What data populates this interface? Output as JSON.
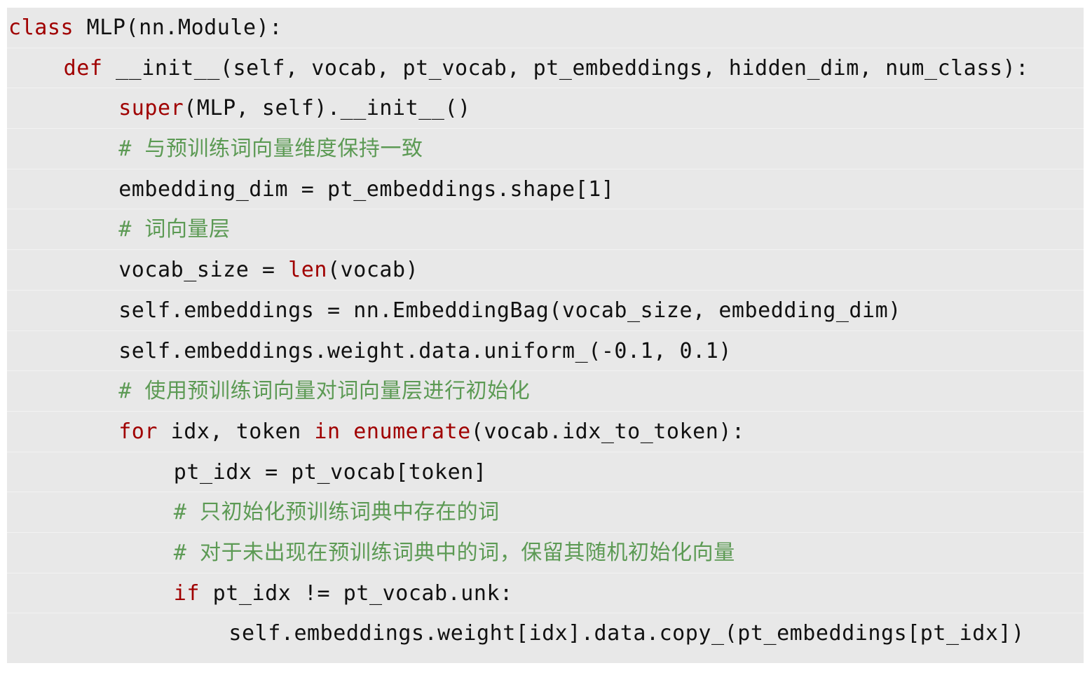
{
  "colors": {
    "background": "#e8e8e8",
    "text": "#111111",
    "keyword": "#a00000",
    "comment": "#5c9a54"
  },
  "code": {
    "lines": [
      {
        "indent": 0,
        "segments": [
          {
            "t": "kw",
            "v": "class"
          },
          {
            "t": "tx",
            "v": " MLP(nn.Module):"
          }
        ]
      },
      {
        "indent": 1,
        "segments": [
          {
            "t": "kw",
            "v": "def"
          },
          {
            "t": "tx",
            "v": " __init__(self, vocab, pt_vocab, pt_embeddings, hidden_dim, num_class):"
          }
        ]
      },
      {
        "indent": 2,
        "segments": [
          {
            "t": "kw",
            "v": "super"
          },
          {
            "t": "tx",
            "v": "(MLP, self).__init__()"
          }
        ]
      },
      {
        "indent": 2,
        "segments": [
          {
            "t": "cm",
            "v": "# 与预训练词向量维度保持一致"
          }
        ]
      },
      {
        "indent": 2,
        "segments": [
          {
            "t": "tx",
            "v": "embedding_dim = pt_embeddings.shape[1]"
          }
        ]
      },
      {
        "indent": 2,
        "segments": [
          {
            "t": "cm",
            "v": "# 词向量层"
          }
        ]
      },
      {
        "indent": 2,
        "segments": [
          {
            "t": "tx",
            "v": "vocab_size = "
          },
          {
            "t": "kw",
            "v": "len"
          },
          {
            "t": "tx",
            "v": "(vocab)"
          }
        ]
      },
      {
        "indent": 2,
        "segments": [
          {
            "t": "tx",
            "v": "self.embeddings = nn.EmbeddingBag(vocab_size, embedding_dim)"
          }
        ]
      },
      {
        "indent": 2,
        "segments": [
          {
            "t": "tx",
            "v": "self.embeddings.weight.data.uniform_(-0.1, 0.1)"
          }
        ]
      },
      {
        "indent": 2,
        "segments": [
          {
            "t": "cm",
            "v": "# 使用预训练词向量对词向量层进行初始化"
          }
        ]
      },
      {
        "indent": 2,
        "segments": [
          {
            "t": "kw",
            "v": "for"
          },
          {
            "t": "tx",
            "v": " idx, token "
          },
          {
            "t": "kw",
            "v": "in"
          },
          {
            "t": "tx",
            "v": " "
          },
          {
            "t": "kw",
            "v": "enumerate"
          },
          {
            "t": "tx",
            "v": "(vocab.idx_to_token):"
          }
        ]
      },
      {
        "indent": 3,
        "segments": [
          {
            "t": "tx",
            "v": "pt_idx = pt_vocab[token]"
          }
        ]
      },
      {
        "indent": 3,
        "segments": [
          {
            "t": "cm",
            "v": "# 只初始化预训练词典中存在的词"
          }
        ]
      },
      {
        "indent": 3,
        "segments": [
          {
            "t": "cm",
            "v": "# 对于未出现在预训练词典中的词，保留其随机初始化向量"
          }
        ]
      },
      {
        "indent": 3,
        "segments": [
          {
            "t": "kw",
            "v": "if"
          },
          {
            "t": "tx",
            "v": " pt_idx != pt_vocab.unk:"
          }
        ]
      },
      {
        "indent": 4,
        "segments": [
          {
            "t": "tx",
            "v": "self.embeddings.weight[idx].data.copy_(pt_embeddings[pt_idx])"
          }
        ]
      }
    ]
  }
}
